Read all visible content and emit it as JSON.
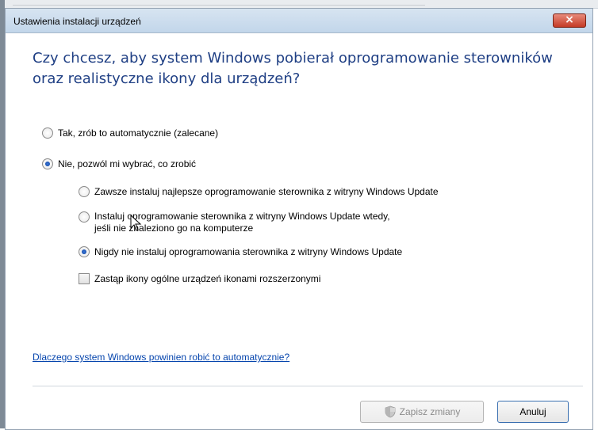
{
  "window": {
    "title": "Ustawienia instalacji urządzeń",
    "close_symbol": "×"
  },
  "heading": "Czy chcesz, aby system Windows pobierał oprogramowanie sterowników oraz realistyczne ikony dla urządzeń?",
  "options": [
    {
      "label": "Tak, zrób to automatycznie (zalecane)",
      "checked": false
    },
    {
      "label": "Nie, pozwól mi wybrać, co zrobić",
      "checked": true
    }
  ],
  "sub_options": [
    {
      "label": "Zawsze instaluj najlepsze oprogramowanie sterownika z witryny Windows Update",
      "checked": false
    },
    {
      "label": "Instaluj oprogramowanie sterownika z witryny Windows Update wtedy,",
      "label_line2": "jeśli nie znaleziono go na komputerze",
      "checked": false
    },
    {
      "label": "Nigdy nie instaluj oprogramowania sterownika z witryny Windows Update",
      "checked": true
    }
  ],
  "checkbox": {
    "label": "Zastąp ikony ogólne urządzeń ikonami rozszerzonymi",
    "checked": false
  },
  "link": "Dlaczego system Windows powinien robić to automatycznie?",
  "buttons": {
    "save": "Zapisz zmiany",
    "cancel": "Anuluj"
  },
  "icons": {
    "close": "close-icon",
    "shield": "uac-shield-icon",
    "cursor": "mouse-cursor-icon"
  }
}
